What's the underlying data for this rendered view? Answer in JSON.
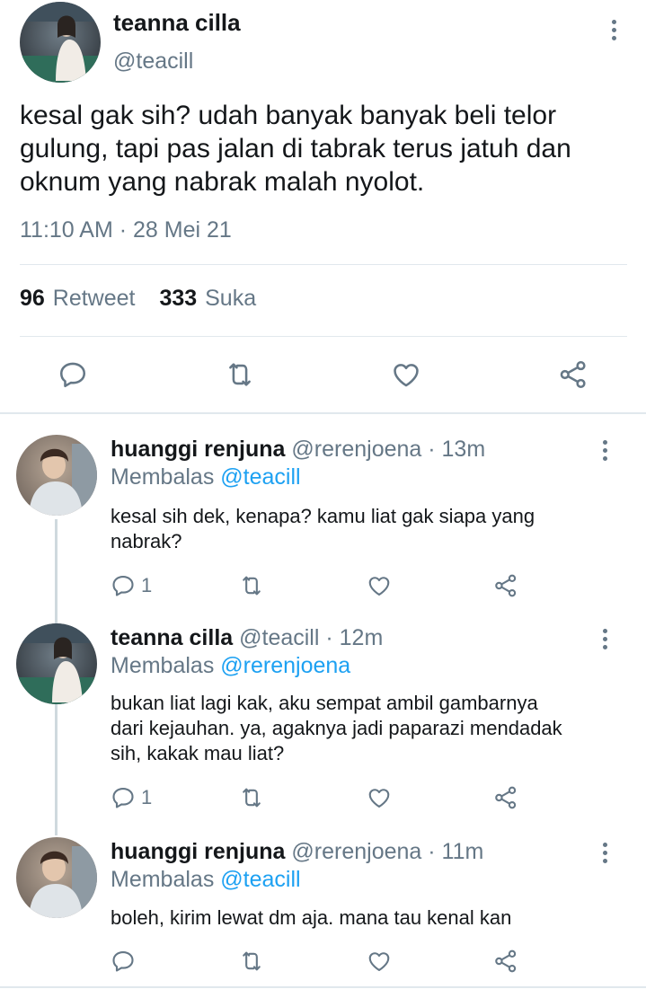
{
  "tweet": {
    "display_name": "teanna cilla",
    "handle": "@teacill",
    "text_lines": [
      "kesal gak sih? udah banyak banyak beli telor",
      "gulung, tapi pas jalan di tabrak terus jatuh dan",
      "oknum yang nabrak malah nyolot."
    ],
    "timestamp": "11:10 AM · 28 Mei 21",
    "retweet_count": "96",
    "retweet_label": "Retweet",
    "like_count": "333",
    "like_label": "Suka"
  },
  "replies": [
    {
      "display_name": "huanggi renjuna",
      "meta": "@rerenjoena · 13m",
      "replying_prefix": "Membalas",
      "replying_to": "@teacill",
      "text_lines": [
        "kesal sih dek, kenapa? kamu liat gak siapa yang",
        "nabrak?"
      ],
      "reply_count": "1"
    },
    {
      "display_name": "teanna cilla",
      "meta": "@teacill · 12m",
      "replying_prefix": "Membalas",
      "replying_to": "@rerenjoena",
      "text_lines": [
        "bukan liat lagi kak, aku sempat ambil gambarnya",
        "dari kejauhan. ya, agaknya jadi paparazi mendadak",
        "sih, kakak mau liat?"
      ],
      "reply_count": "1"
    },
    {
      "display_name": "huanggi renjuna",
      "meta": "@rerenjoena · 11m",
      "replying_prefix": "Membalas",
      "replying_to": "@teacill",
      "text_lines": [
        "boleh, kirim lewat dm aja. mana tau kenal kan"
      ],
      "reply_count": ""
    }
  ],
  "icons": {
    "reply": "reply-icon",
    "retweet": "retweet-icon",
    "like": "heart-icon",
    "share": "share-icon",
    "more": "more-vertical-icon"
  },
  "colors": {
    "text": "#14171a",
    "muted": "#657786",
    "link": "#1da1f2",
    "divider": "#e1e8ed"
  }
}
